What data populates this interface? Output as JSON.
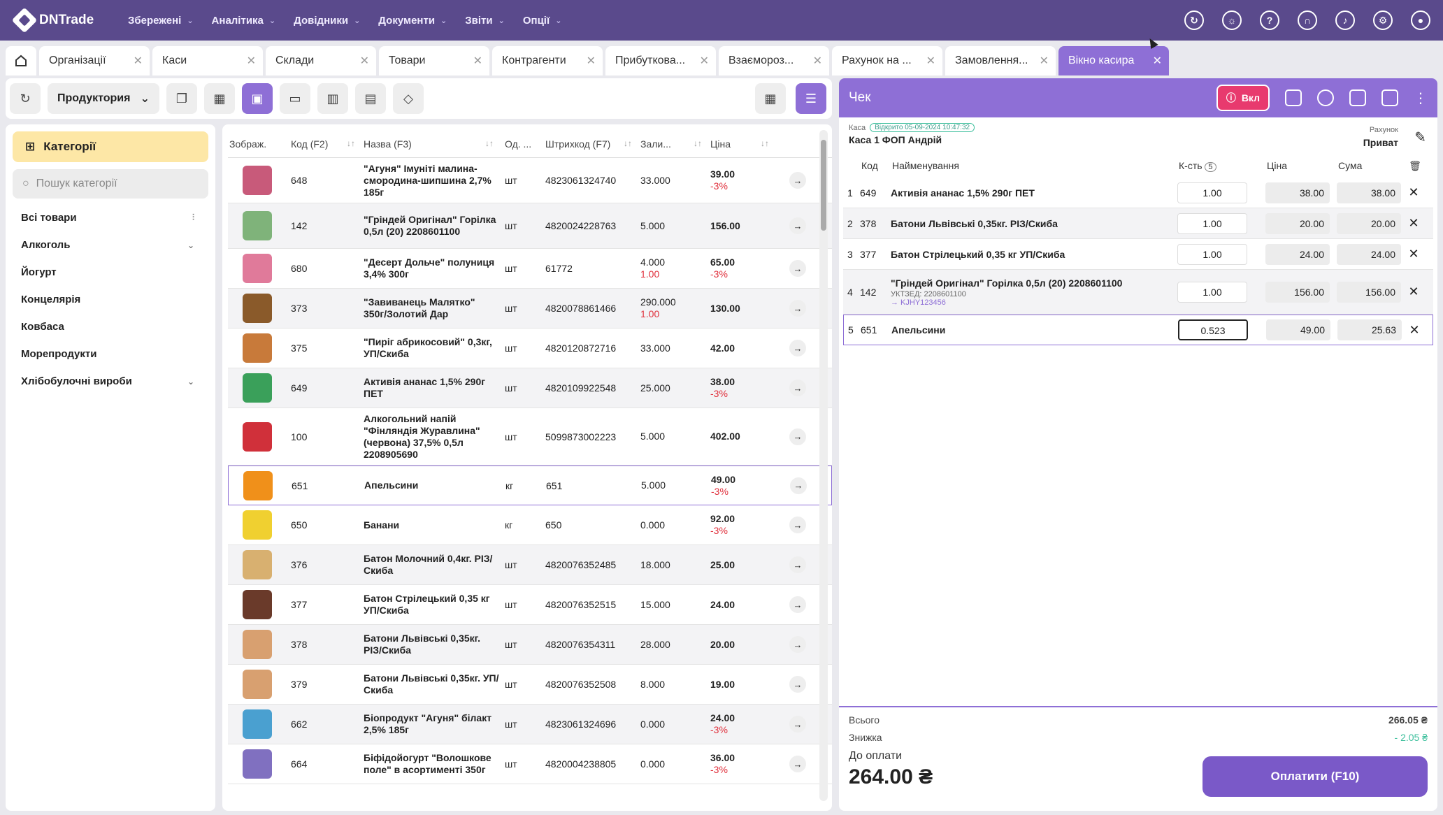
{
  "app": {
    "name": "DNTrade"
  },
  "menu": [
    {
      "label": "Збережені"
    },
    {
      "label": "Аналітика"
    },
    {
      "label": "Довідники"
    },
    {
      "label": "Документи"
    },
    {
      "label": "Звіти"
    },
    {
      "label": "Опції"
    }
  ],
  "tabs": [
    {
      "label": "Організації"
    },
    {
      "label": "Каси"
    },
    {
      "label": "Склади"
    },
    {
      "label": "Товари"
    },
    {
      "label": "Контрагенти"
    },
    {
      "label": "Прибуткова..."
    },
    {
      "label": "Взаємороз..."
    },
    {
      "label": "Рахунок на ..."
    },
    {
      "label": "Замовлення..."
    },
    {
      "label": "Вікно касира"
    }
  ],
  "toolbar": {
    "group": "Продуктория"
  },
  "categories": {
    "header": "Категорії",
    "search_placeholder": "Пошук категорії",
    "items": [
      {
        "label": "Всі товари"
      },
      {
        "label": "Алкоголь"
      },
      {
        "label": "Йогурт"
      },
      {
        "label": "Концелярія"
      },
      {
        "label": "Ковбаса"
      },
      {
        "label": "Морепродукти"
      },
      {
        "label": "Хлібобулочні вироби"
      }
    ]
  },
  "products": {
    "headers": {
      "img": "Зображ.",
      "code": "Код (F2)",
      "name": "Назва (F3)",
      "unit": "Од. ...",
      "barcode": "Штрихкод (F7)",
      "stock": "Зали...",
      "price": "Ціна"
    },
    "rows": [
      {
        "code": "648",
        "name": "\"Агуня\" Імуніті малина-смородина-шипшина 2,7% 185г",
        "unit": "шт",
        "barcode": "4823061324740",
        "stock": "33.000",
        "stock2": "",
        "price": "39.00",
        "disc": "-3%",
        "color": "#c85a7a"
      },
      {
        "code": "142",
        "name": "\"Гріндей Оригінал\" Горілка 0,5л (20) 2208601100",
        "unit": "шт",
        "barcode": "4820024228763",
        "stock": "5.000",
        "stock2": "",
        "price": "156.00",
        "disc": "",
        "color": "#7fb37a"
      },
      {
        "code": "680",
        "name": "\"Десерт Дольче\" полуниця 3,4% 300г",
        "unit": "шт",
        "barcode": "61772",
        "stock": "4.000",
        "stock2": "1.00",
        "price": "65.00",
        "disc": "-3%",
        "color": "#e07a9a"
      },
      {
        "code": "373",
        "name": "\"Завиванець Малятко\" 350г/Золотий Дар",
        "unit": "шт",
        "barcode": "4820078861466",
        "stock": "290.000",
        "stock2": "1.00",
        "price": "130.00",
        "disc": "",
        "color": "#8a5a2a"
      },
      {
        "code": "375",
        "name": "\"Пиріг абрикосовий\" 0,3кг, УП/Скиба",
        "unit": "шт",
        "barcode": "4820120872716",
        "stock": "33.000",
        "stock2": "",
        "price": "42.00",
        "disc": "",
        "color": "#c87a3a"
      },
      {
        "code": "649",
        "name": "Активія ананас 1,5% 290г ПЕТ",
        "unit": "шт",
        "barcode": "4820109922548",
        "stock": "25.000",
        "stock2": "",
        "price": "38.00",
        "disc": "-3%",
        "color": "#3aa05a"
      },
      {
        "code": "100",
        "name": "Алкогольний напій \"Фінляндія Журавлина\" (червона) 37,5% 0,5л 2208905690",
        "unit": "шт",
        "barcode": "5099873002223",
        "stock": "5.000",
        "stock2": "",
        "price": "402.00",
        "disc": "",
        "color": "#d0303a"
      },
      {
        "code": "651",
        "name": "Апельсини",
        "unit": "кг",
        "barcode": "651",
        "stock": "5.000",
        "stock2": "",
        "price": "49.00",
        "disc": "-3%",
        "color": "#f0901a"
      },
      {
        "code": "650",
        "name": "Банани",
        "unit": "кг",
        "barcode": "650",
        "stock": "0.000",
        "stock2": "",
        "price": "92.00",
        "disc": "-3%",
        "color": "#f0d030"
      },
      {
        "code": "376",
        "name": "Батон Молочний 0,4кг. РІЗ/Скиба",
        "unit": "шт",
        "barcode": "4820076352485",
        "stock": "18.000",
        "stock2": "",
        "price": "25.00",
        "disc": "",
        "color": "#d8b070"
      },
      {
        "code": "377",
        "name": "Батон Стрілецький 0,35 кг УП/Скиба",
        "unit": "шт",
        "barcode": "4820076352515",
        "stock": "15.000",
        "stock2": "",
        "price": "24.00",
        "disc": "",
        "color": "#6a3a2a"
      },
      {
        "code": "378",
        "name": "Батони Львівські 0,35кг. РІЗ/Скиба",
        "unit": "шт",
        "barcode": "4820076354311",
        "stock": "28.000",
        "stock2": "",
        "price": "20.00",
        "disc": "",
        "color": "#d8a070"
      },
      {
        "code": "379",
        "name": "Батони Львівські 0,35кг. УП/Скиба",
        "unit": "шт",
        "barcode": "4820076352508",
        "stock": "8.000",
        "stock2": "",
        "price": "19.00",
        "disc": "",
        "color": "#d8a070"
      },
      {
        "code": "662",
        "name": "Біопродукт \"Агуня\" білакт 2,5% 185г",
        "unit": "шт",
        "barcode": "4823061324696",
        "stock": "0.000",
        "stock2": "",
        "price": "24.00",
        "disc": "-3%",
        "color": "#4aa0d0"
      },
      {
        "code": "664",
        "name": "Біфідойогурт \"Волошкове поле\" в асортименті 350г",
        "unit": "шт",
        "barcode": "4820004238805",
        "stock": "0.000",
        "stock2": "",
        "price": "36.00",
        "disc": "-3%",
        "color": "#8070c0"
      }
    ]
  },
  "check": {
    "title": "Чек",
    "toggle": "Вкл",
    "kasa_label": "Каса",
    "kasa_badge": "Відкрито 05-09-2024 10:47:32",
    "kasa_value": "Каса 1 ФОП Андрій",
    "account_label": "Рахунок",
    "account_value": "Приват",
    "headers": {
      "code": "Код",
      "name": "Найменування",
      "qty": "К-сть",
      "qty_count": "5",
      "price": "Ціна",
      "sum": "Сума"
    },
    "rows": [
      {
        "n": "1",
        "code": "649",
        "name": "Активія ананас 1,5% 290г ПЕТ",
        "sub": "",
        "link": "",
        "qty": "1.00",
        "price": "38.00",
        "sum": "38.00"
      },
      {
        "n": "2",
        "code": "378",
        "name": "Батони Львівські 0,35кг. РІЗ/Скиба",
        "sub": "",
        "link": "",
        "qty": "1.00",
        "price": "20.00",
        "sum": "20.00"
      },
      {
        "n": "3",
        "code": "377",
        "name": "Батон Стрілецький 0,35 кг УП/Скиба",
        "sub": "",
        "link": "",
        "qty": "1.00",
        "price": "24.00",
        "sum": "24.00"
      },
      {
        "n": "4",
        "code": "142",
        "name": "\"Гріндей Оригінал\" Горілка 0,5л (20) 2208601100",
        "sub": "УКТЗЕД: 2208601100",
        "link": "→ KJHY123456",
        "qty": "1.00",
        "price": "156.00",
        "sum": "156.00"
      },
      {
        "n": "5",
        "code": "651",
        "name": "Апельсини",
        "sub": "",
        "link": "",
        "qty": "0.523",
        "price": "49.00",
        "sum": "25.63"
      }
    ],
    "total_label": "Всього",
    "total_value": "266.05 ₴",
    "discount_label": "Знижка",
    "discount_value": "- 2.05 ₴",
    "topay_label": "До оплати",
    "topay_value": "264.00 ₴",
    "pay_button": "Оплатити (F10)"
  }
}
